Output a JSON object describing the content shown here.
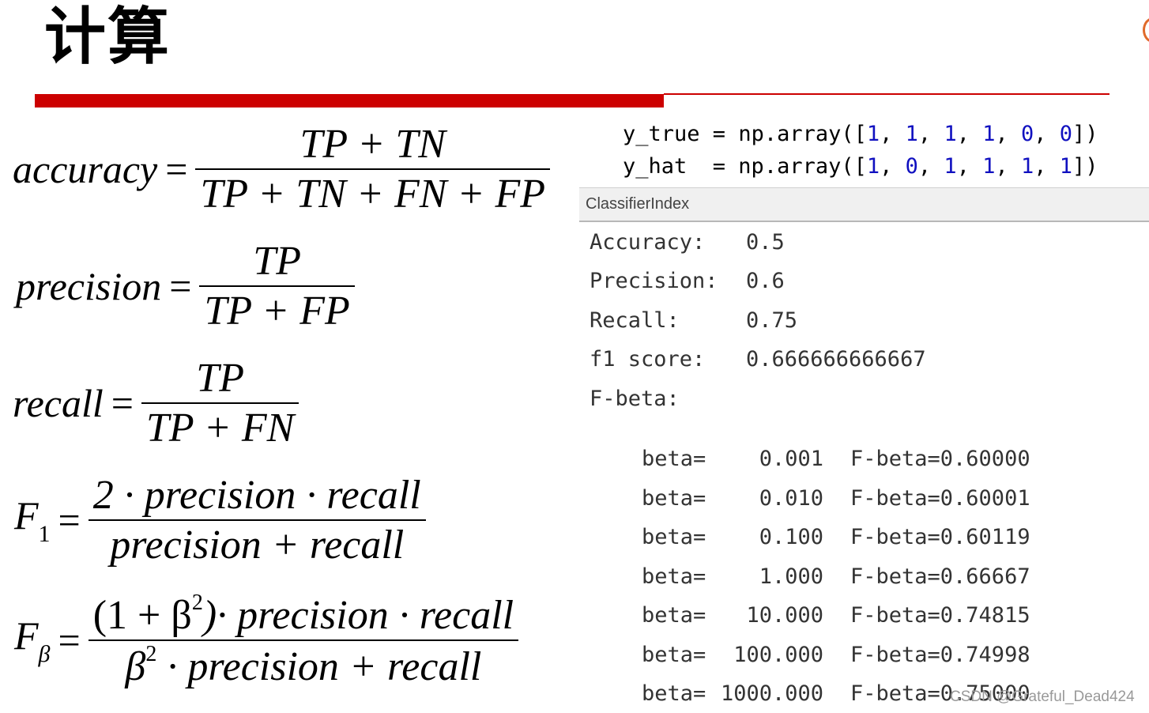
{
  "title": "计算",
  "formulas": {
    "accuracy": {
      "lhs": "accuracy",
      "eq": "=",
      "num": "TP + TN",
      "den": "TP + TN + FN + FP"
    },
    "precision": {
      "lhs": "precision",
      "eq": "=",
      "num": "TP",
      "den": "TP + FP"
    },
    "recall": {
      "lhs": "recall",
      "eq": "=",
      "num": "TP",
      "den": "TP + FN"
    },
    "f1": {
      "lhs": "F",
      "sub": "1",
      "eq": "=",
      "num": "2 · precision · recall",
      "den": "precision + recall"
    },
    "fbeta": {
      "lhs": "F",
      "sub": "β",
      "eq": "=",
      "num_open": "(1 + β",
      "num_sup": "2",
      "num_close": ")· precision · recall",
      "den_pre": "β",
      "den_sup": "2",
      "den_post": " · precision + recall"
    }
  },
  "code": {
    "y_true_var": "y_true",
    "y_true_eq": " = np.array([",
    "y_true_vals": [
      "1",
      "1",
      "1",
      "1",
      "0",
      "0"
    ],
    "y_hat_var": "y_hat",
    "y_hat_eq": "  = np.array([",
    "y_hat_vals": [
      "1",
      "0",
      "1",
      "1",
      "1",
      "1"
    ],
    "sep": ", ",
    "close": "])"
  },
  "panel": {
    "title": "ClassifierIndex"
  },
  "output": {
    "accuracy_label": "Accuracy:",
    "accuracy_value": "0.5",
    "precision_label": "Precision:",
    "precision_value": "0.6",
    "recall_label": "Recall:",
    "recall_value": "0.75",
    "f1_label": "f1 score:",
    "f1_value": "0.666666666667",
    "fbeta_label": "F-beta:",
    "beta_rows": [
      {
        "label": "beta=",
        "beta": "0.001",
        "fbeta": "F-beta=0.60000"
      },
      {
        "label": "beta=",
        "beta": "0.010",
        "fbeta": "F-beta=0.60001"
      },
      {
        "label": "beta=",
        "beta": "0.100",
        "fbeta": "F-beta=0.60119"
      },
      {
        "label": "beta=",
        "beta": "1.000",
        "fbeta": "F-beta=0.66667"
      },
      {
        "label": "beta=",
        "beta": "10.000",
        "fbeta": "F-beta=0.74815"
      },
      {
        "label": "beta=",
        "beta": "100.000",
        "fbeta": "F-beta=0.74998"
      },
      {
        "label": "beta=",
        "beta": "1000.000",
        "fbeta": "F-beta=0.75000"
      }
    ]
  },
  "watermark": "CSDN @Grateful_Dead424",
  "colors": {
    "accent_red": "#cc0000",
    "number_blue": "#1010c0",
    "panel_bg": "#f0f0f0"
  }
}
